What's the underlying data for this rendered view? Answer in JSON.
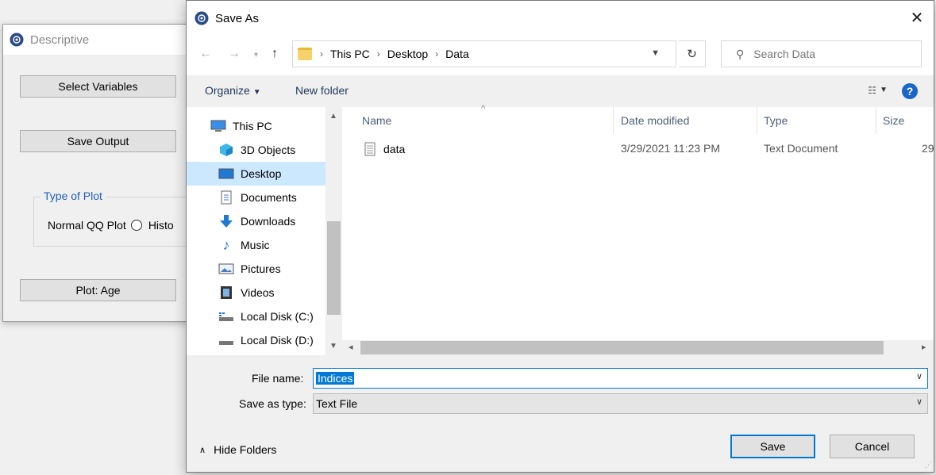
{
  "descriptive": {
    "title": "Descriptive",
    "select_variables": "Select Variables",
    "save_output": "Save Output",
    "type_of_plot": "Type of Plot",
    "normal_qq": "Normal QQ Plot",
    "histo": "Histo",
    "plot_age": "Plot: Age"
  },
  "dialog": {
    "title": "Save As",
    "breadcrumbs": [
      "This PC",
      "Desktop",
      "Data"
    ],
    "search_placeholder": "Search Data",
    "toolbar": {
      "organize": "Organize",
      "new_folder": "New folder"
    },
    "tree": [
      {
        "label": "This PC",
        "icon": "pc-icon"
      },
      {
        "label": "3D Objects",
        "icon": "cube-icon"
      },
      {
        "label": "Desktop",
        "icon": "desktop-icon",
        "selected": true
      },
      {
        "label": "Documents",
        "icon": "document-icon"
      },
      {
        "label": "Downloads",
        "icon": "download-icon"
      },
      {
        "label": "Music",
        "icon": "music-icon"
      },
      {
        "label": "Pictures",
        "icon": "pictures-icon"
      },
      {
        "label": "Videos",
        "icon": "video-icon"
      },
      {
        "label": "Local Disk (C:)",
        "icon": "drive-icon"
      },
      {
        "label": "Local Disk (D:)",
        "icon": "drive-icon"
      }
    ],
    "columns": [
      "Name",
      "Date modified",
      "Type",
      "Size"
    ],
    "files": [
      {
        "name": "data",
        "date": "3/29/2021 11:23 PM",
        "type": "Text Document",
        "size": "29"
      }
    ],
    "file_name_label": "File name:",
    "file_name_value": "Indices",
    "save_type_label": "Save as type:",
    "save_type_value": "Text File",
    "hide_folders": "Hide Folders",
    "save": "Save",
    "cancel": "Cancel"
  }
}
